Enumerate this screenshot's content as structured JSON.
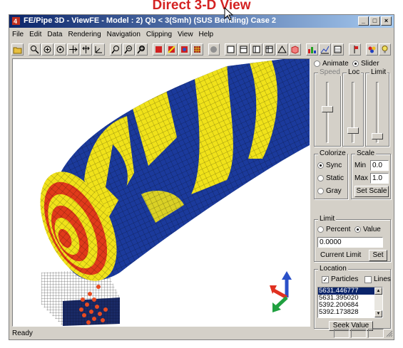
{
  "caption": "Direct 3-D View",
  "window": {
    "title": "FE/Pipe 3D - ViewFE - Model :     2) Qb < 3(Smh) (SUS Bending) Case 2",
    "controls": [
      "_",
      "□",
      "×"
    ]
  },
  "menu": [
    "File",
    "Edit",
    "Data",
    "Rendering",
    "Navigation",
    "Clipping",
    "View",
    "Help"
  ],
  "toolbar_icons": [
    "open-icon",
    "zoom-icon",
    "rotate-icon",
    "orbit-icon",
    "pan-icon",
    "tilt-icon",
    "axis-icon",
    "zoom-in-icon",
    "zoom-out-icon",
    "zoom-fit-icon",
    "render-red-icon",
    "render-mixed-icon",
    "render-shade-icon",
    "render-wire-icon",
    "sphere-icon",
    "view-front-icon",
    "view-side-icon",
    "view-top-icon",
    "view-iso-icon",
    "triangle-icon",
    "color-cube-icon",
    "bar-chart-icon",
    "line-chart-icon",
    "stack-icon",
    "flag-icon",
    "palette-icon",
    "help-bulb-icon"
  ],
  "panel": {
    "mode": {
      "animate": "Animate",
      "slider": "Slider",
      "selected": "slider"
    },
    "sliders": {
      "speed": "Speed",
      "loc": "Loc",
      "limit": "Limit"
    },
    "colorize": {
      "label": "Colorize",
      "options": [
        "Sync",
        "Static",
        "Gray"
      ],
      "selected": "Sync"
    },
    "scale": {
      "label": "Scale",
      "min_label": "Min",
      "min_value": "0.0",
      "max_label": "Max",
      "max_value": "1.0",
      "button": "Set Scale"
    },
    "limit": {
      "label": "Limit",
      "percent": "Percent",
      "value": "Value",
      "selected": "Value",
      "field": "0.0000",
      "current_label": "Current Limit",
      "set_button": "Set"
    },
    "location": {
      "label": "Location",
      "particles": "Particles",
      "particles_checked": true,
      "lines": "Lines",
      "lines_checked": false,
      "items": [
        "5631.446777",
        "5631.395020",
        "5392.200684",
        "5392.173828"
      ],
      "selected_index": 0,
      "seek_button": "Seek Value"
    }
  },
  "status": {
    "text": "Ready"
  },
  "colors": {
    "mesh_blue": "#1b3a9c",
    "mesh_yellow": "#f0e21a",
    "mesh_red": "#e03a1a",
    "title_bar": "#0a246a",
    "caption": "#d42222"
  }
}
